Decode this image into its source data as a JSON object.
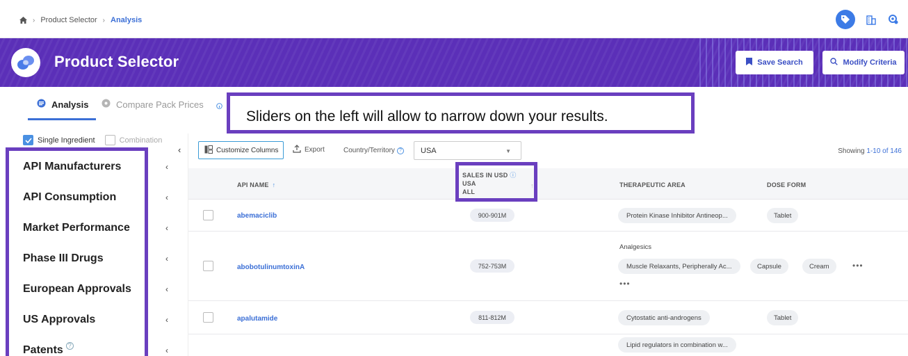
{
  "breadcrumb": {
    "items": [
      "Product Selector",
      "Analysis"
    ]
  },
  "header": {
    "title": "Product Selector",
    "save_label": "Save Search",
    "modify_label": "Modify Criteria"
  },
  "tabs": [
    {
      "label": "Analysis",
      "active": true
    },
    {
      "label": "Compare Pack Prices",
      "active": false
    }
  ],
  "callout": {
    "text": "Sliders on the left will allow to narrow down your results."
  },
  "ingredient_toggle": {
    "single": "Single Ingredient",
    "combination": "Combination",
    "single_checked": true,
    "combination_checked": false
  },
  "filters": [
    {
      "label": "API Manufacturers"
    },
    {
      "label": "API Consumption"
    },
    {
      "label": "Market Performance"
    },
    {
      "label": "Phase III Drugs"
    },
    {
      "label": "European Approvals"
    },
    {
      "label": "US Approvals"
    },
    {
      "label": "Patents"
    }
  ],
  "toolbar": {
    "customize_label": "Customize Columns",
    "export_label": "Export",
    "country_label": "Country/Territory",
    "country_value": "USA",
    "showing_prefix": "Showing ",
    "showing_range": "1-10 of 146"
  },
  "table": {
    "headers": {
      "api": "API NAME",
      "sales_line1": "SALES IN USD",
      "sales_line2": "USA",
      "sales_line3": "ALL",
      "area": "THERAPEUTIC AREA",
      "dose": "DOSE FORM"
    },
    "rows": [
      {
        "api": "abemaciclib",
        "sales": "900-901M",
        "areas": [
          "Protein Kinase Inhibitor Antineop..."
        ],
        "doses": [
          "Tablet"
        ]
      },
      {
        "api": "abobotulinumtoxinA",
        "sales": "752-753M",
        "areas": [
          "Analgesics",
          "Muscle Relaxants, Peripherally Ac..."
        ],
        "doses": [
          "Capsule",
          "Cream"
        ]
      },
      {
        "api": "apalutamide",
        "sales": "811-812M",
        "areas": [
          "Cytostatic anti-androgens"
        ],
        "doses": [
          "Tablet"
        ]
      },
      {
        "api": "",
        "sales": "",
        "areas": [
          "Lipid regulators in combination w..."
        ],
        "doses": []
      }
    ]
  },
  "colors": {
    "brand": "#5b2fb8",
    "accent": "#3b6fd6",
    "highlight": "#6a3fbf"
  },
  "icons": [
    "home-icon",
    "tag-icon",
    "building-icon",
    "settings-icon",
    "bookmark-icon",
    "search-icon",
    "columns-icon",
    "export-icon",
    "info-icon",
    "help-icon"
  ]
}
